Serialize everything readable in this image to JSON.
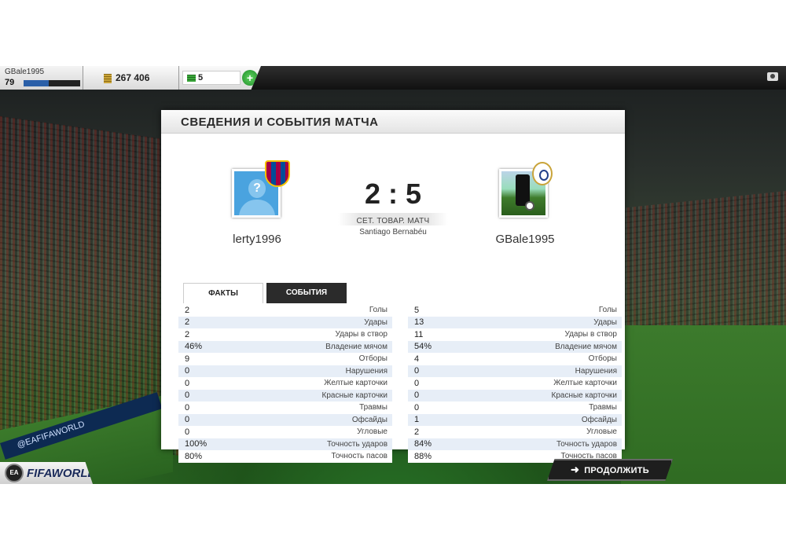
{
  "topbar": {
    "username": "GBale1995",
    "level": "79",
    "xp_fraction": 0.45,
    "coins": "267 406",
    "points": "5",
    "add_points_label": "+"
  },
  "dialog": {
    "title": "СВЕДЕНИЯ И СОБЫТИЯ МАТЧА",
    "home_player": "lerty1996",
    "away_player": "GBale1995",
    "home_avatar_glyph": "?",
    "score": "2 : 5",
    "match_type": "СЕТ. ТОВАР. МАТЧ",
    "stadium": "Santiago Bernabéu",
    "tabs": {
      "facts": "ФАКТЫ",
      "events": "СОБЫТИЯ"
    }
  },
  "stats": {
    "home": [
      {
        "value": "2",
        "label": "Голы"
      },
      {
        "value": "2",
        "label": "Удары"
      },
      {
        "value": "2",
        "label": "Удары в створ"
      },
      {
        "value": "46%",
        "label": "Владение мячом"
      },
      {
        "value": "9",
        "label": "Отборы"
      },
      {
        "value": "0",
        "label": "Нарушения"
      },
      {
        "value": "0",
        "label": "Желтые карточки"
      },
      {
        "value": "0",
        "label": "Красные карточки"
      },
      {
        "value": "0",
        "label": "Травмы"
      },
      {
        "value": "0",
        "label": "Офсайды"
      },
      {
        "value": "0",
        "label": "Угловые"
      },
      {
        "value": "100%",
        "label": "Точность ударов"
      },
      {
        "value": "80%",
        "label": "Точность пасов"
      }
    ],
    "away": [
      {
        "value": "5",
        "label": "Голы"
      },
      {
        "value": "13",
        "label": "Удары"
      },
      {
        "value": "11",
        "label": "Удары в створ"
      },
      {
        "value": "54%",
        "label": "Владение мячом"
      },
      {
        "value": "4",
        "label": "Отборы"
      },
      {
        "value": "0",
        "label": "Нарушения"
      },
      {
        "value": "0",
        "label": "Желтые карточки"
      },
      {
        "value": "0",
        "label": "Красные карточки"
      },
      {
        "value": "0",
        "label": "Травмы"
      },
      {
        "value": "1",
        "label": "Офсайды"
      },
      {
        "value": "2",
        "label": "Угловые"
      },
      {
        "value": "84%",
        "label": "Точность ударов"
      },
      {
        "value": "88%",
        "label": "Точность пасов"
      }
    ]
  },
  "footer": {
    "logo_text": "FIFAWORLD",
    "ea_text": "EA",
    "continue_label": "ПРОДОЛЖИТЬ",
    "continue_arrow": "➜"
  },
  "background": {
    "ad_text": "@EAFIFAWORLD"
  }
}
